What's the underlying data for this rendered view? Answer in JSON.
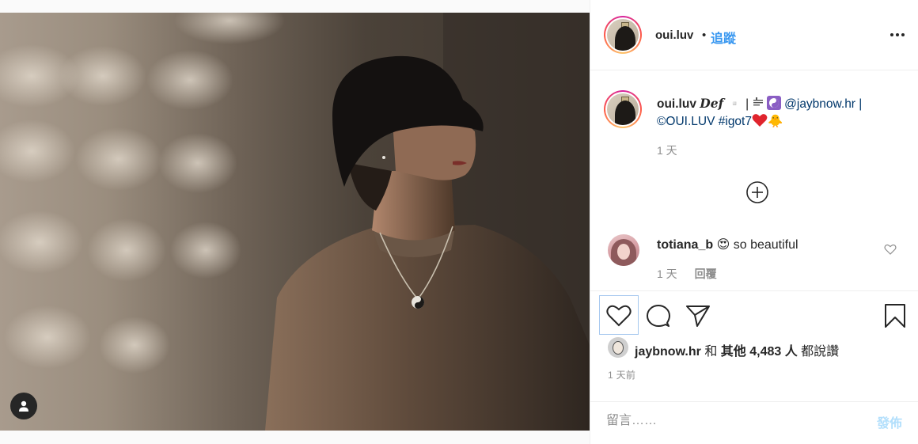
{
  "post": {
    "username": "oui.luv",
    "separator": "•",
    "follow_label": "追蹤"
  },
  "caption": {
    "username": "oui.luv",
    "styled_name": "𝑫𝒆𝒇",
    "body_1": "▫️ | ",
    "body_2": " @jaybnow.hr | ©OUI.LUV ",
    "hashtag": "#igot7",
    "emoji_end": "🐥",
    "time": "1 天"
  },
  "comment": {
    "username": "totiana_b",
    "emoji": "😍",
    "text": "so beautiful",
    "time": "1 天",
    "reply_label": "回覆"
  },
  "likes": {
    "liker": "jaybnow.hr",
    "and": "和",
    "others_label": "其他 4,483 人",
    "suffix": "都說讚",
    "time_ago": "1 天前"
  },
  "comment_box": {
    "placeholder": "留言……",
    "post_label": "發佈"
  },
  "colors": {
    "link": "#3897f0",
    "mention": "#00376b",
    "muted": "#8e8e8e",
    "post_disabled": "#b2dffc"
  }
}
